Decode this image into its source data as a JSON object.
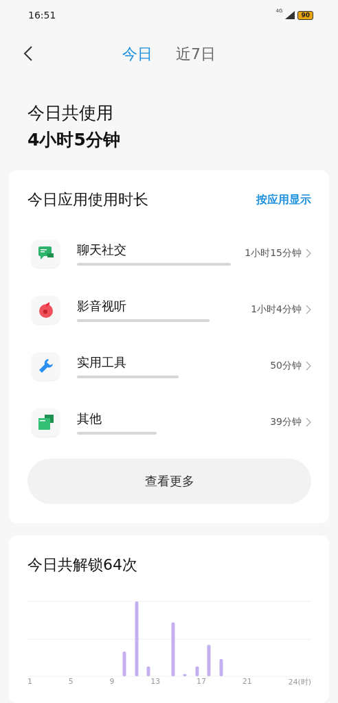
{
  "status_bar": {
    "time": "16:51",
    "network": "4G",
    "battery": "90"
  },
  "tabs": [
    {
      "label": "今日",
      "selected": true
    },
    {
      "label": "近7日",
      "selected": false
    }
  ],
  "summary": {
    "title": "今日共使用",
    "total": "4小时5分钟"
  },
  "usage_card": {
    "title": "今日应用使用时长",
    "action": "按应用显示",
    "items": [
      {
        "kind": "chat",
        "name": "聊天社交",
        "duration": "1小时15分钟"
      },
      {
        "kind": "media",
        "name": "影音视听",
        "duration": "1小时4分钟"
      },
      {
        "kind": "tool",
        "name": "实用工具",
        "duration": "50分钟"
      },
      {
        "kind": "other",
        "name": "其他",
        "duration": "39分钟"
      }
    ],
    "more_button": "查看更多"
  },
  "unlock_card": {
    "title": "今日共解锁64次",
    "x_labels": [
      "1",
      "5",
      "9",
      "13",
      "17",
      "21",
      "24(时)"
    ]
  }
}
